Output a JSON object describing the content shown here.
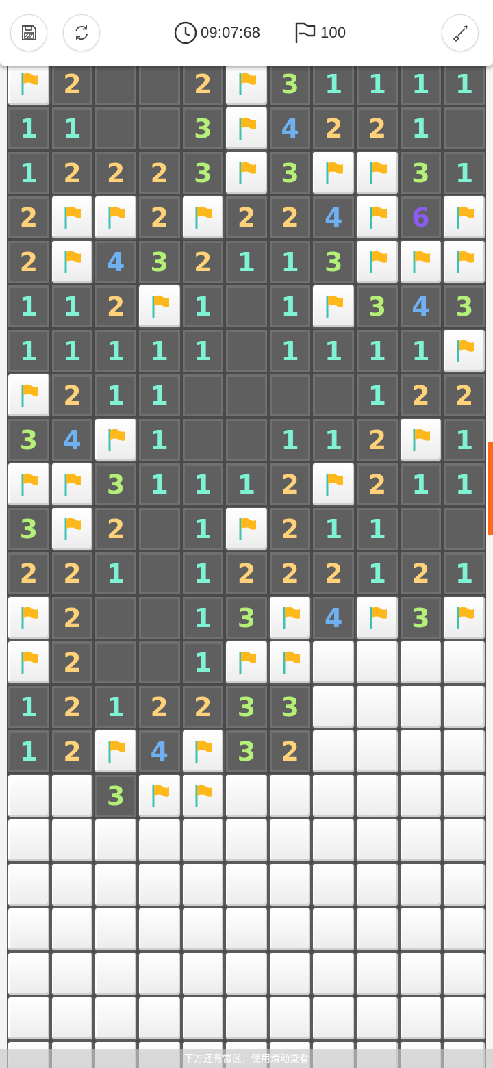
{
  "header": {
    "timer": "09:07:68",
    "flag_count": "100",
    "icons": [
      "save-icon",
      "restart-icon",
      "clock-icon",
      "flag-icon",
      "shovel-icon"
    ]
  },
  "colors": {
    "accent": "#ff6a1a",
    "flag": "#ffb81c",
    "n1": "#7ff2d4",
    "n2": "#ffd27a",
    "n3": "#b4f078",
    "n4": "#6fb0f0",
    "n6": "#8a5cf0"
  },
  "board": {
    "legend": "U = covered, F = flag, . = revealed empty, digits = mine count",
    "rows": [
      "F2..2F31111",
      "11..3F4221.",
      "12223F3FF31",
      "2FF2F224F6F",
      "2F432113FFF",
      "112F1.1F343",
      "11111.1111F",
      "F211....122",
      "34F1..112F1",
      "FF31112F211",
      "3F2.1F211..",
      "221.1222121",
      "F2..13F4F3F",
      "F2..1FFUUUU",
      "1212233UUUU",
      "12F4F32UUUU",
      "UU3FFUUUUUU",
      "UUUUUUUUUUU",
      "UUUUUUUUUUU",
      "UUUUUUUUUUU",
      "UUUUUUUUUUU",
      "UUUUUUUUUUU",
      "UUUUUUUUUUU"
    ]
  },
  "footer": {
    "hint": "下方还有雷区，使用滑动查看"
  }
}
